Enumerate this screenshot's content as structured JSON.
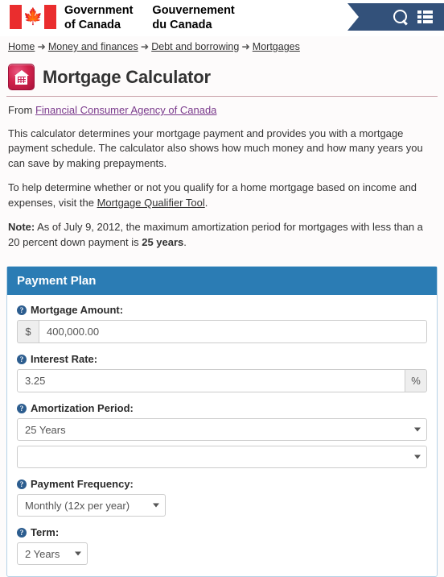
{
  "header": {
    "flag_alt": "canada-flag",
    "wordmark_en": "Government\nof Canada",
    "wordmark_fr": "Gouvernement\ndu Canada",
    "search_icon": "search-icon",
    "menu_icon": "menu-icon",
    "ribbon_color": "#33517a"
  },
  "breadcrumb": {
    "separator": "➜",
    "items": [
      {
        "label": "Home"
      },
      {
        "label": "Money and finances"
      },
      {
        "label": "Debt and borrowing"
      },
      {
        "label": "Mortgages"
      }
    ]
  },
  "page": {
    "icon": "mortgage-calculator-icon",
    "title": "Mortgage Calculator",
    "from_prefix": "From ",
    "from_link": "Financial Consumer Agency of Canada",
    "accent_red": "#c8134a"
  },
  "intro": {
    "paragraph1": "This calculator determines your mortgage payment and provides you with a mortgage payment schedule. The calculator also shows how much money and how many years you can save by making prepayments.",
    "paragraph2_before": "To help determine whether or not you qualify for a home mortgage based on income and expenses, visit the ",
    "paragraph2_link": "Mortgage Qualifier Tool",
    "paragraph2_after": ".",
    "note_label": "Note:",
    "note_before": " As of July 9, 2012, the maximum amortization period for mortgages with less than a 20 percent down payment is ",
    "note_bold": "25 years",
    "note_after": "."
  },
  "panel": {
    "title": "Payment Plan",
    "header_color": "#2b7cb4",
    "help_glyph": "?",
    "fields": {
      "mortgage_amount": {
        "label": "Mortgage Amount:",
        "prefix": "$",
        "value": "400,000.00",
        "placeholder": ""
      },
      "interest_rate": {
        "label": "Interest Rate:",
        "suffix": "%",
        "value": "3.25",
        "placeholder": ""
      },
      "amortization_period": {
        "label": "Amortization Period:",
        "years_value": "25 Years",
        "months_value": ""
      },
      "payment_frequency": {
        "label": "Payment Frequency:",
        "value": "Monthly (12x per year)"
      },
      "term": {
        "label": "Term:",
        "value": "2 Years"
      }
    }
  }
}
